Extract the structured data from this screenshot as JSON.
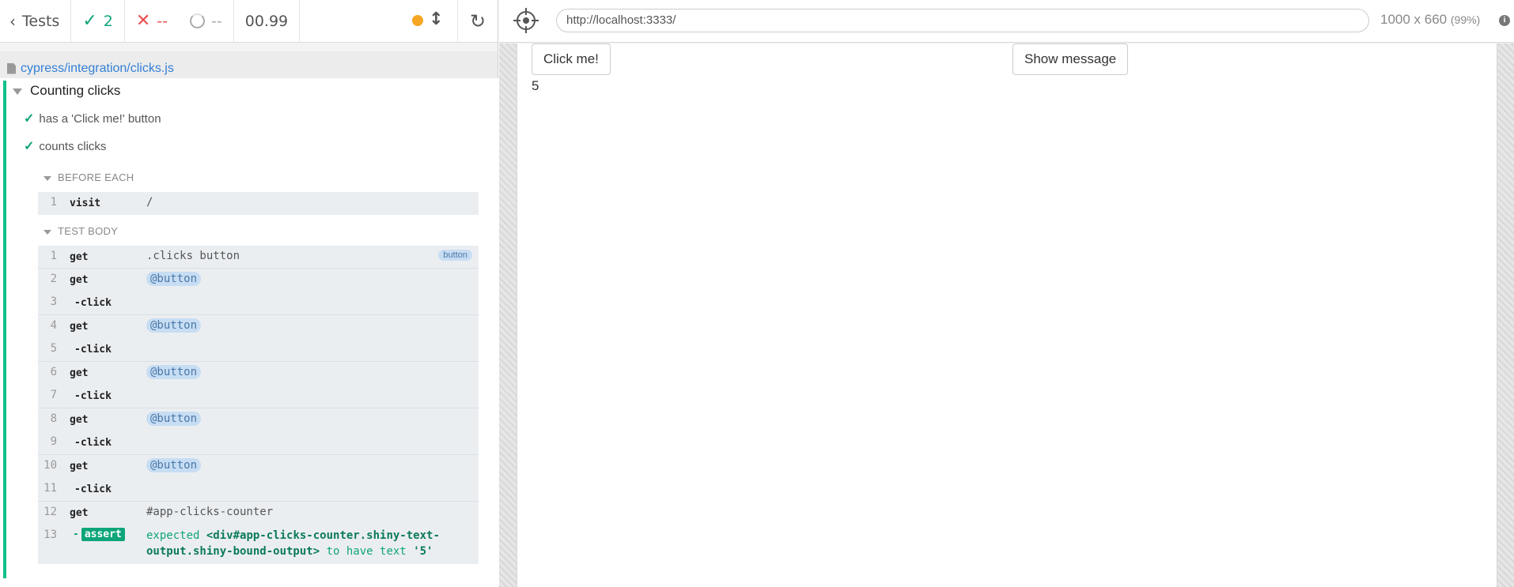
{
  "header": {
    "tests_label": "Tests",
    "passed": "2",
    "failed": "--",
    "pending": "--",
    "duration": "00.99"
  },
  "spec_file": "cypress/integration/clicks.js",
  "suite": {
    "title": "Counting clicks",
    "tests": [
      "has a 'Click me!' button",
      "counts clicks"
    ]
  },
  "before_each": {
    "title": "BEFORE EACH",
    "commands": [
      {
        "num": "1",
        "name": "visit",
        "message": "/"
      }
    ]
  },
  "test_body": {
    "title": "TEST BODY",
    "first": {
      "num": "1",
      "name": "get",
      "message": ".clicks button",
      "tag": "button"
    },
    "groups": [
      {
        "get_num": "2",
        "get_name": "get",
        "alias": "@button",
        "click_num": "3",
        "click_name": "-click"
      },
      {
        "get_num": "4",
        "get_name": "get",
        "alias": "@button",
        "click_num": "5",
        "click_name": "-click"
      },
      {
        "get_num": "6",
        "get_name": "get",
        "alias": "@button",
        "click_num": "7",
        "click_name": "-click"
      },
      {
        "get_num": "8",
        "get_name": "get",
        "alias": "@button",
        "click_num": "9",
        "click_name": "-click"
      },
      {
        "get_num": "10",
        "get_name": "get",
        "alias": "@button",
        "click_num": "11",
        "click_name": "-click"
      }
    ],
    "last_get": {
      "num": "12",
      "name": "get",
      "message": "#app-clicks-counter"
    },
    "assert": {
      "num": "13",
      "dash": "-",
      "name": "assert",
      "expected": "expected",
      "subject": "<div#app-clicks-counter.shiny-text-output.shiny-bound-output>",
      "to_have_text": "to have text",
      "value": "'5'"
    }
  },
  "aut": {
    "url": "http://localhost:3333/",
    "viewport": "1000 x 660",
    "zoom": "(99%)",
    "info": "i",
    "click_button": "Click me!",
    "show_button": "Show message",
    "counter": "5"
  },
  "colors": {
    "pass": "#0fa57a",
    "fail": "#e94f4f",
    "link": "#3380d6",
    "running_dot": "#f5a623"
  },
  "icons": [
    "chevron-left-icon",
    "check-icon",
    "x-icon",
    "pending-circle-icon",
    "status-dot-icon",
    "scroll-arrows-icon",
    "reload-icon",
    "file-icon",
    "caret-down-icon",
    "crosshair-icon",
    "info-icon"
  ]
}
